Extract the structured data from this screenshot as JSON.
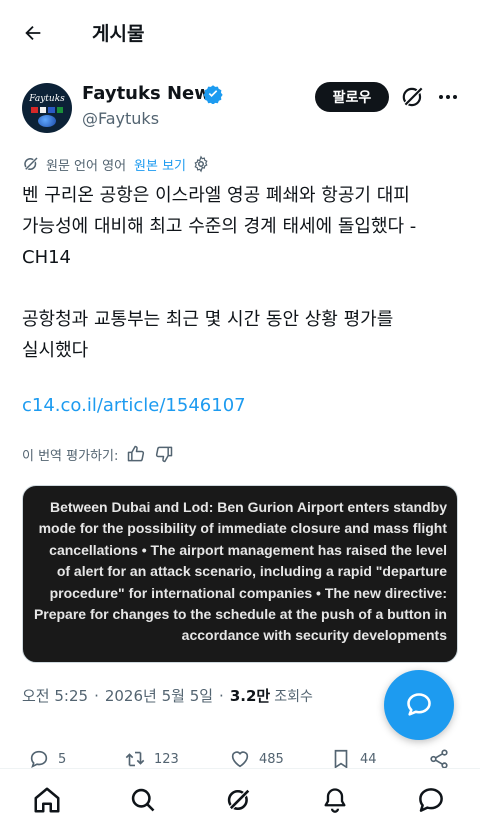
{
  "header": {
    "title": "게시물"
  },
  "author": {
    "display_name": "Faytuks News",
    "handle": "@Faytuks",
    "avatar_text": "Faytuks",
    "verified_color": "#1d9bf0"
  },
  "actions": {
    "follow_label": "팔로우"
  },
  "translation": {
    "source_label": "원문 언어 영어",
    "show_original": "원본 보기"
  },
  "post": {
    "text": "벤 구리온 공항은 이스라엘 영공 폐쇄와 항공기 대피 가능성에 대비해 최고 수준의 경계 태세에 돌입했다 - CH14\n\n공항청과 교통부는 최근 몇 시간 동안 상황 평가를 실시했다",
    "link": "c14.co.il/article/1546107"
  },
  "rating": {
    "label": "이 번역 평가하기:"
  },
  "media": {
    "text": "Between Dubai and Lod: Ben Gurion Airport enters standby mode for the possibility of immediate closure and mass flight cancellations • The airport management has raised the level of alert for an attack scenario, including a rapid \"departure procedure\" for international companies • The new directive: Prepare for changes to the schedule at the push of a button in accordance with security developments"
  },
  "meta": {
    "time": "오전 5:25",
    "date": "2026년 5월 5일",
    "views_count": "3.2만",
    "views_label": "조회수"
  },
  "engagement": {
    "replies": "5",
    "reposts": "123",
    "likes": "485",
    "bookmarks": "44"
  },
  "colors": {
    "accent": "#1d9bf0",
    "text": "#0f1419",
    "secondary": "#536471"
  }
}
